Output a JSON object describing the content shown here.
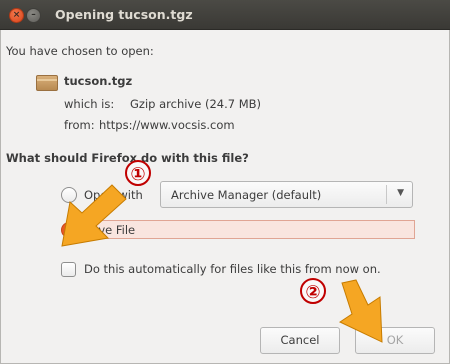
{
  "window": {
    "title": "Opening tucson.tgz",
    "close_glyph": "×",
    "min_glyph": "–"
  },
  "dialog": {
    "intro": "You have chosen to open:",
    "file_name": "tucson.tgz",
    "which_is_label": "which is:",
    "which_is_value": "Gzip archive (24.7 MB)",
    "from_label": "from:",
    "from_value": "https://www.vocsis.com",
    "question": "What should Firefox do with this file?",
    "open_with_label": "Open with",
    "open_with_app": "Archive Manager (default)",
    "save_file_label": "Save File",
    "auto_label": "Do this automatically for files like this from now on."
  },
  "buttons": {
    "cancel": "Cancel",
    "ok": "OK"
  },
  "annotations": {
    "marker_1": "①",
    "marker_2": "②",
    "arrow_color": "#f5a623",
    "marker_color": "#c00000"
  },
  "icons": {
    "file": "archive-file-icon",
    "dropdown": "chevron-down-icon"
  }
}
